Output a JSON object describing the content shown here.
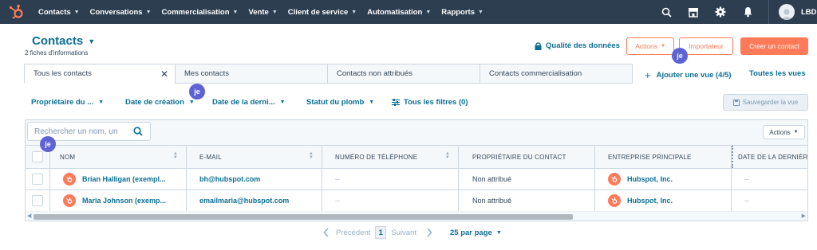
{
  "topnav": {
    "items": [
      {
        "label": "Contacts"
      },
      {
        "label": "Conversations"
      },
      {
        "label": "Commercialisation"
      },
      {
        "label": "Vente"
      },
      {
        "label": "Client de service"
      },
      {
        "label": "Automatisation"
      },
      {
        "label": "Rapports"
      }
    ],
    "user": "LBD"
  },
  "header": {
    "title": "Contacts",
    "subtitle": "2 fiches d'informations",
    "quality_link": "Qualité des données",
    "actions_label": "Actions",
    "import_label": "Importateur",
    "create_label": "Créer un contact"
  },
  "tabs": [
    {
      "label": "Tous les contacts"
    },
    {
      "label": "Mes contacts"
    },
    {
      "label": "Contacts non attribués"
    },
    {
      "label": "Contacts commercialisation"
    }
  ],
  "views": {
    "add_view": "Ajouter une vue (4/5)",
    "all_views": "Toutes les vues"
  },
  "filters": {
    "owner": "Propriétaire du ...",
    "created": "Date de création",
    "last": "Date de la derni...",
    "lead_status": "Statut du plomb",
    "all_filters": "Tous les filtres (0)",
    "save_view": "Sauvegarder la vue"
  },
  "search": {
    "placeholder": "Rechercher un nom, un"
  },
  "table_actions": "Actions",
  "columns": [
    "NOM",
    "E-MAIL",
    "NUMÉRO DE TÉLÉPHONE",
    "PROPRIÉTAIRE DU CONTACT",
    "ENTREPRISE PRINCIPALE",
    "DATE DE LA DERNIÈR"
  ],
  "rows": [
    {
      "name": "Brian Halligan (exempl...",
      "email": "bh@hubspot.com",
      "phone": "--",
      "owner": "Non attribué",
      "company": "Hubspot, Inc.",
      "last": "--"
    },
    {
      "name": "Maria Johnson (exemp...",
      "email": "emailmaria@hubspot.com",
      "phone": "--",
      "owner": "Non attribué",
      "company": "Hubspot, Inc.",
      "last": "--"
    }
  ],
  "pagination": {
    "prev": "Précédent",
    "page": "1",
    "next": "Suivant",
    "per_page": "25 par page"
  },
  "badge_label": "je",
  "colors": {
    "nav": "#2d3e50",
    "accent": "#ff7a59",
    "link": "#0b6f94",
    "badge": "#5d63d7"
  }
}
